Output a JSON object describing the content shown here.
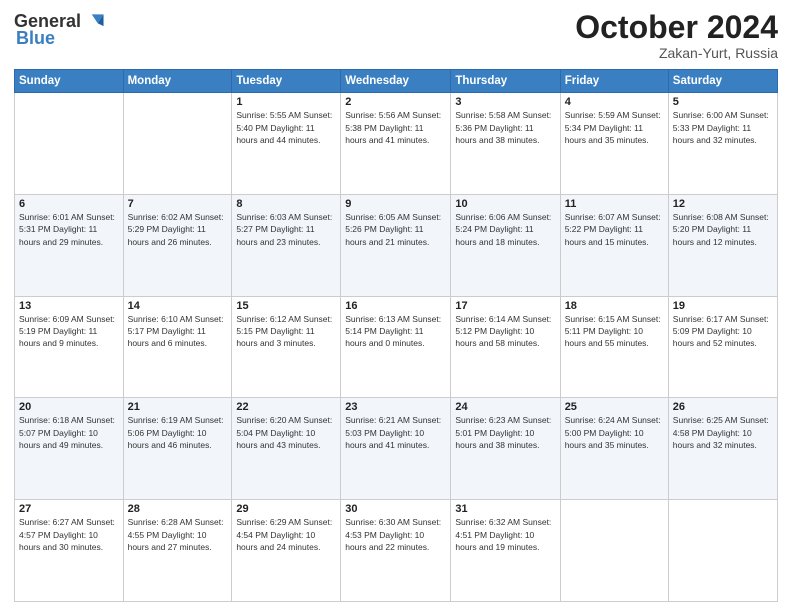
{
  "header": {
    "logo_general": "General",
    "logo_blue": "Blue",
    "month": "October 2024",
    "location": "Zakan-Yurt, Russia"
  },
  "days_of_week": [
    "Sunday",
    "Monday",
    "Tuesday",
    "Wednesday",
    "Thursday",
    "Friday",
    "Saturday"
  ],
  "weeks": [
    [
      {
        "day": "",
        "info": ""
      },
      {
        "day": "",
        "info": ""
      },
      {
        "day": "1",
        "info": "Sunrise: 5:55 AM\nSunset: 5:40 PM\nDaylight: 11 hours and 44 minutes."
      },
      {
        "day": "2",
        "info": "Sunrise: 5:56 AM\nSunset: 5:38 PM\nDaylight: 11 hours and 41 minutes."
      },
      {
        "day": "3",
        "info": "Sunrise: 5:58 AM\nSunset: 5:36 PM\nDaylight: 11 hours and 38 minutes."
      },
      {
        "day": "4",
        "info": "Sunrise: 5:59 AM\nSunset: 5:34 PM\nDaylight: 11 hours and 35 minutes."
      },
      {
        "day": "5",
        "info": "Sunrise: 6:00 AM\nSunset: 5:33 PM\nDaylight: 11 hours and 32 minutes."
      }
    ],
    [
      {
        "day": "6",
        "info": "Sunrise: 6:01 AM\nSunset: 5:31 PM\nDaylight: 11 hours and 29 minutes."
      },
      {
        "day": "7",
        "info": "Sunrise: 6:02 AM\nSunset: 5:29 PM\nDaylight: 11 hours and 26 minutes."
      },
      {
        "day": "8",
        "info": "Sunrise: 6:03 AM\nSunset: 5:27 PM\nDaylight: 11 hours and 23 minutes."
      },
      {
        "day": "9",
        "info": "Sunrise: 6:05 AM\nSunset: 5:26 PM\nDaylight: 11 hours and 21 minutes."
      },
      {
        "day": "10",
        "info": "Sunrise: 6:06 AM\nSunset: 5:24 PM\nDaylight: 11 hours and 18 minutes."
      },
      {
        "day": "11",
        "info": "Sunrise: 6:07 AM\nSunset: 5:22 PM\nDaylight: 11 hours and 15 minutes."
      },
      {
        "day": "12",
        "info": "Sunrise: 6:08 AM\nSunset: 5:20 PM\nDaylight: 11 hours and 12 minutes."
      }
    ],
    [
      {
        "day": "13",
        "info": "Sunrise: 6:09 AM\nSunset: 5:19 PM\nDaylight: 11 hours and 9 minutes."
      },
      {
        "day": "14",
        "info": "Sunrise: 6:10 AM\nSunset: 5:17 PM\nDaylight: 11 hours and 6 minutes."
      },
      {
        "day": "15",
        "info": "Sunrise: 6:12 AM\nSunset: 5:15 PM\nDaylight: 11 hours and 3 minutes."
      },
      {
        "day": "16",
        "info": "Sunrise: 6:13 AM\nSunset: 5:14 PM\nDaylight: 11 hours and 0 minutes."
      },
      {
        "day": "17",
        "info": "Sunrise: 6:14 AM\nSunset: 5:12 PM\nDaylight: 10 hours and 58 minutes."
      },
      {
        "day": "18",
        "info": "Sunrise: 6:15 AM\nSunset: 5:11 PM\nDaylight: 10 hours and 55 minutes."
      },
      {
        "day": "19",
        "info": "Sunrise: 6:17 AM\nSunset: 5:09 PM\nDaylight: 10 hours and 52 minutes."
      }
    ],
    [
      {
        "day": "20",
        "info": "Sunrise: 6:18 AM\nSunset: 5:07 PM\nDaylight: 10 hours and 49 minutes."
      },
      {
        "day": "21",
        "info": "Sunrise: 6:19 AM\nSunset: 5:06 PM\nDaylight: 10 hours and 46 minutes."
      },
      {
        "day": "22",
        "info": "Sunrise: 6:20 AM\nSunset: 5:04 PM\nDaylight: 10 hours and 43 minutes."
      },
      {
        "day": "23",
        "info": "Sunrise: 6:21 AM\nSunset: 5:03 PM\nDaylight: 10 hours and 41 minutes."
      },
      {
        "day": "24",
        "info": "Sunrise: 6:23 AM\nSunset: 5:01 PM\nDaylight: 10 hours and 38 minutes."
      },
      {
        "day": "25",
        "info": "Sunrise: 6:24 AM\nSunset: 5:00 PM\nDaylight: 10 hours and 35 minutes."
      },
      {
        "day": "26",
        "info": "Sunrise: 6:25 AM\nSunset: 4:58 PM\nDaylight: 10 hours and 32 minutes."
      }
    ],
    [
      {
        "day": "27",
        "info": "Sunrise: 6:27 AM\nSunset: 4:57 PM\nDaylight: 10 hours and 30 minutes."
      },
      {
        "day": "28",
        "info": "Sunrise: 6:28 AM\nSunset: 4:55 PM\nDaylight: 10 hours and 27 minutes."
      },
      {
        "day": "29",
        "info": "Sunrise: 6:29 AM\nSunset: 4:54 PM\nDaylight: 10 hours and 24 minutes."
      },
      {
        "day": "30",
        "info": "Sunrise: 6:30 AM\nSunset: 4:53 PM\nDaylight: 10 hours and 22 minutes."
      },
      {
        "day": "31",
        "info": "Sunrise: 6:32 AM\nSunset: 4:51 PM\nDaylight: 10 hours and 19 minutes."
      },
      {
        "day": "",
        "info": ""
      },
      {
        "day": "",
        "info": ""
      }
    ]
  ]
}
